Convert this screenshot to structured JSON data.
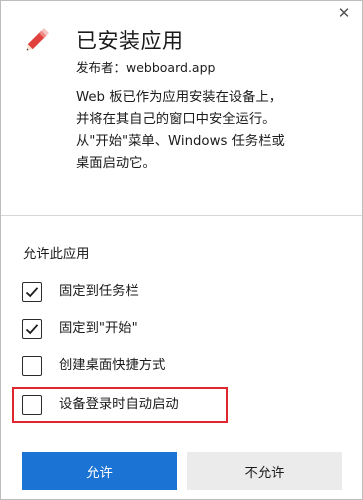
{
  "dialog": {
    "close_glyph": "✕",
    "app_icon": "pencil-icon",
    "title": "已安装应用",
    "publisher": "发布者：webboard.app",
    "description": "Web 板已作为应用安装在设备上，并将在其自己的窗口中安全运行。从\"开始\"菜单、Windows 任务栏或桌面启动它。"
  },
  "permissions": {
    "label": "允许此应用",
    "options": [
      {
        "label": "固定到任务栏",
        "checked": true
      },
      {
        "label": "固定到\"开始\"",
        "checked": true
      },
      {
        "label": "创建桌面快捷方式",
        "checked": false
      },
      {
        "label": "设备登录时自动启动",
        "checked": false
      }
    ]
  },
  "buttons": {
    "allow": "允许",
    "deny": "不允许"
  },
  "colors": {
    "accent": "#1b73d3",
    "icon_red": "#e0413c",
    "highlight": "#e0262e"
  }
}
